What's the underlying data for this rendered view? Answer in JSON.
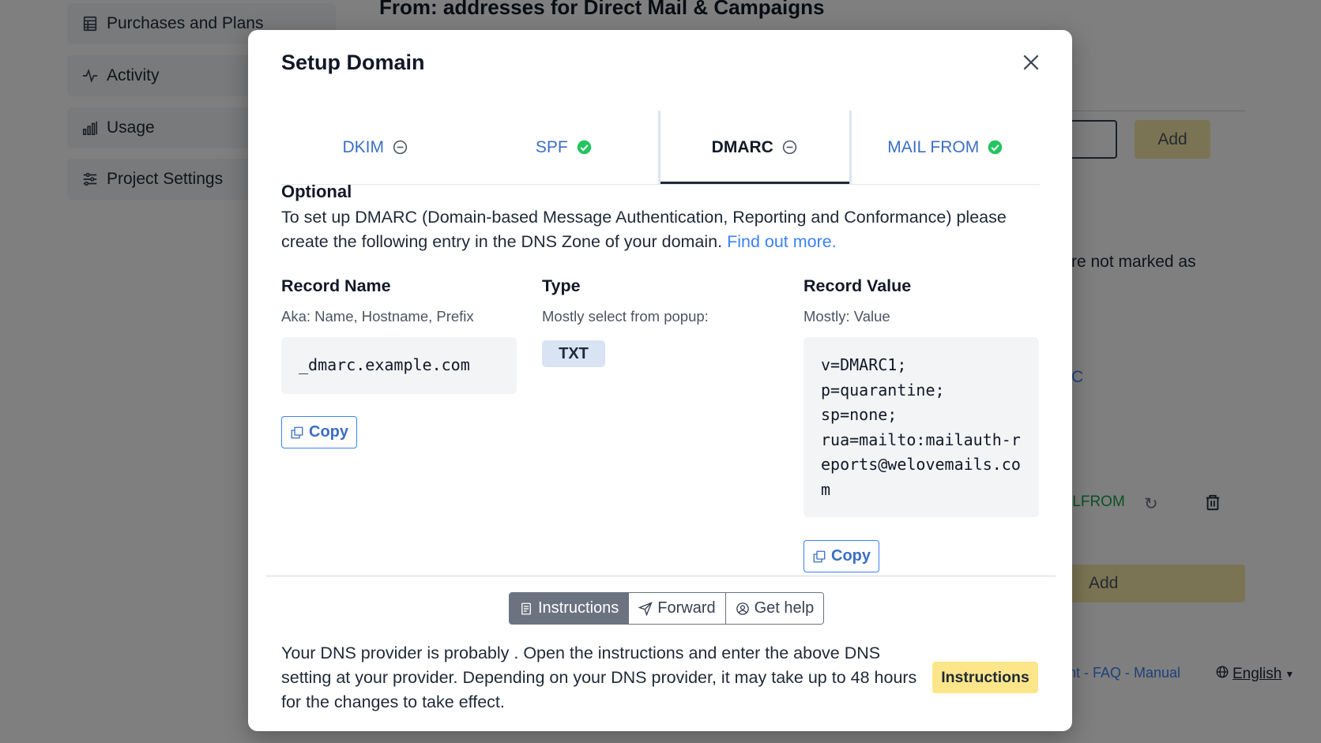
{
  "background": {
    "sidebar": [
      {
        "label": "Purchases and Plans",
        "icon": "table-icon"
      },
      {
        "label": "Activity",
        "icon": "activity-icon"
      },
      {
        "label": "Usage",
        "icon": "bar-chart-icon"
      },
      {
        "label": "Project Settings",
        "icon": "sliders-icon"
      }
    ],
    "heading": "From: addresses for Direct Mail & Campaigns",
    "add_small": "Add",
    "partial_text": "re not marked as",
    "partial_link": "C",
    "mailfrom_partial": "ILFROM",
    "add_large": "Add",
    "footer_links": "nt - FAQ - Manual",
    "language": "English"
  },
  "modal": {
    "title": "Setup Domain",
    "tabs": [
      {
        "label": "DKIM",
        "status": "pending"
      },
      {
        "label": "SPF",
        "status": "ok"
      },
      {
        "label": "DMARC",
        "status": "pending",
        "active": true
      },
      {
        "label": "MAIL FROM",
        "status": "ok"
      }
    ],
    "optional_label": "Optional",
    "description": "To set up DMARC (Domain-based Message Authentication, Reporting and Conformance) please create the following entry in the DNS Zone of your domain.",
    "find_out_more": "Find out more.",
    "record_name": {
      "heading": "Record Name",
      "sub": "Aka: Name, Hostname, Prefix",
      "value": "_dmarc.example.com",
      "copy_label": "Copy"
    },
    "type": {
      "heading": "Type",
      "sub": "Mostly select from popup:",
      "value": "TXT"
    },
    "record_value": {
      "heading": "Record Value",
      "sub": "Mostly: Value",
      "value": "v=DMARC1;\np=quarantine;\nsp=none;\nrua=mailto:mailauth-reports@welovemails.com",
      "copy_label": "Copy"
    },
    "bottom_tabs": [
      {
        "label": "Instructions",
        "icon": "document-icon",
        "active": true
      },
      {
        "label": "Forward",
        "icon": "send-icon"
      },
      {
        "label": "Get help",
        "icon": "user-circle-icon"
      }
    ],
    "provider_text": "Your DNS provider is probably    . Open the instructions and enter the above DNS setting at your provider. Depending on your DNS provider, it may take up to 48 hours for the changes to take effect.",
    "instructions_button": "Instructions"
  },
  "colors": {
    "link": "#3b82f6",
    "ok": "#22c55e",
    "accent_yellow": "#fde68a"
  }
}
